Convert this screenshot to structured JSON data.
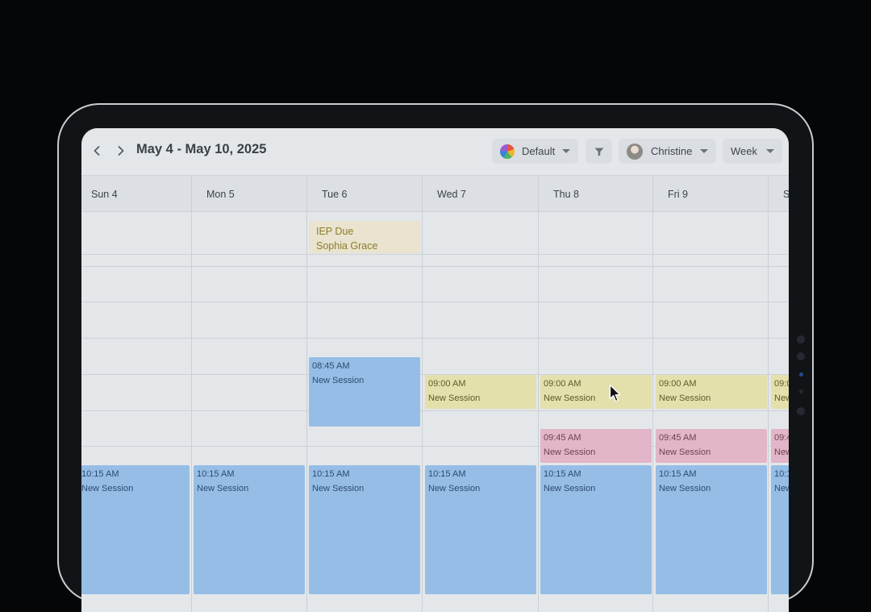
{
  "toolbar": {
    "title": "May 4 - May 10, 2025",
    "prev_icon": "chevron-left-icon",
    "next_icon": "chevron-right-icon",
    "color_filter_label": "Default",
    "filter_icon": "filter-icon",
    "user_label": "Christine",
    "view_label": "Week"
  },
  "days": [
    {
      "label": "Sun 4"
    },
    {
      "label": "Mon 5"
    },
    {
      "label": "Tue 6"
    },
    {
      "label": "Wed 7"
    },
    {
      "label": "Thu 8"
    },
    {
      "label": "Fri 9"
    },
    {
      "label": "S"
    }
  ],
  "events": {
    "iep": {
      "line1": "IEP Due",
      "line2": "Sophia Grace"
    },
    "tue_0845": {
      "time": "08:45 AM",
      "label": "New Session"
    },
    "wed_0900": {
      "time": "09:00 AM",
      "label": "New Session"
    },
    "thu_0900": {
      "time": "09:00 AM",
      "label": "New Session"
    },
    "fri_0900": {
      "time": "09:00 AM",
      "label": "New Session"
    },
    "sat_0900": {
      "time": "09:0",
      "label": "New"
    },
    "thu_0945": {
      "time": "09:45 AM",
      "label": "New Session"
    },
    "fri_0945": {
      "time": "09:45 AM",
      "label": "New Session"
    },
    "sat_0945": {
      "time": "09:4",
      "label": "New"
    },
    "sun_1015": {
      "time": "10:15 AM",
      "label": "New Session"
    },
    "mon_1015": {
      "time": "10:15 AM",
      "label": "New Session"
    },
    "tue_1015": {
      "time": "10:15 AM",
      "label": "New Session"
    },
    "wed_1015": {
      "time": "10:15 AM",
      "label": "New Session"
    },
    "thu_1015": {
      "time": "10:15 AM",
      "label": "New Session"
    },
    "fri_1015": {
      "time": "10:15 AM",
      "label": "New Session"
    },
    "sat_1015": {
      "time": "10:1",
      "label": "New"
    }
  },
  "colors": {
    "session_blue": "#96bde6",
    "session_yellow": "#e4e0ab",
    "session_pink": "#e2b5c8",
    "iep_tan": "#e9e3cf"
  }
}
